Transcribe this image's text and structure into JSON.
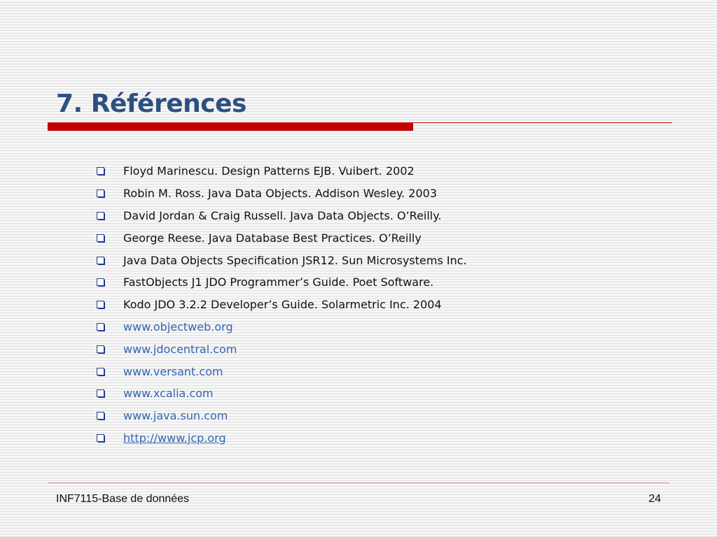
{
  "slide": {
    "title": "7. Références",
    "accent_color": "#c00000",
    "title_color": "#2f4f7f",
    "link_color": "#3466b3",
    "bullet_icon": "hollow-square-bullet-icon"
  },
  "references": [
    {
      "text": "Floyd Marinescu. Design Patterns EJB. Vuibert. 2002",
      "is_link": false
    },
    {
      "text": "Robin M. Ross. Java Data Objects. Addison Wesley. 2003",
      "is_link": false
    },
    {
      "text": "David Jordan & Craig Russell. Java Data Objects. O’Reilly.",
      "is_link": false
    },
    {
      "text": "George Reese. Java Database Best Practices. O’Reilly",
      "is_link": false
    },
    {
      "text": "Java Data Objects Specification JSR12. Sun Microsystems Inc.",
      "is_link": false
    },
    {
      "text": "FastObjects J1 JDO Programmer’s Guide. Poet Software.",
      "is_link": false
    },
    {
      "text": "Kodo JDO 3.2.2 Developer’s Guide. Solarmetric Inc. 2004",
      "is_link": false
    },
    {
      "text": "www.objectweb.org",
      "is_link": true,
      "underlined": false
    },
    {
      "text": "www.jdocentral.com",
      "is_link": true,
      "underlined": false
    },
    {
      "text": "www.versant.com",
      "is_link": true,
      "underlined": false
    },
    {
      "text": "www.xcalia.com",
      "is_link": true,
      "underlined": false
    },
    {
      "text": "www.java.sun.com",
      "is_link": true,
      "underlined": false
    },
    {
      "text": "http://www.jcp.org",
      "is_link": true,
      "underlined": true
    }
  ],
  "footer": {
    "course": "INF7115-Base de données",
    "page_number": "24"
  }
}
